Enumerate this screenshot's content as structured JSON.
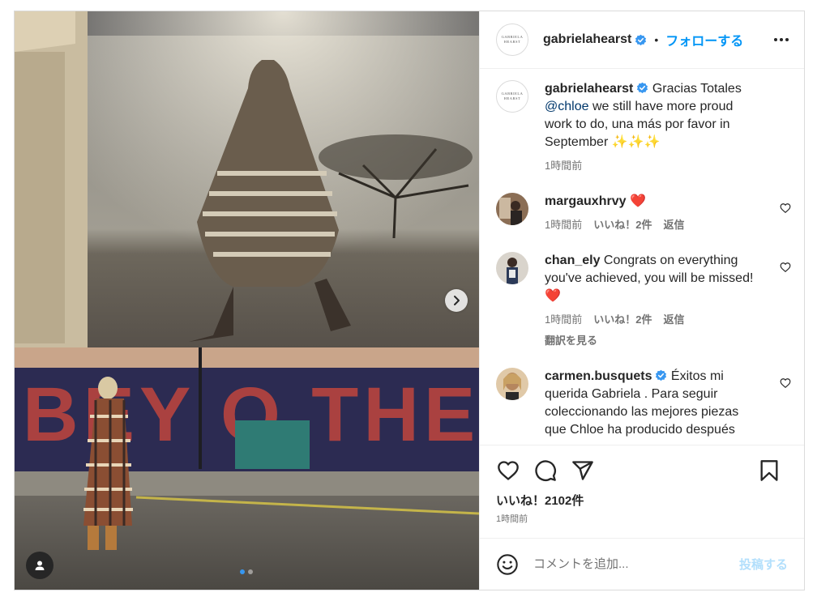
{
  "post": {
    "author": "gabrielahearst",
    "avatar_text": "GABRIELA HEARST",
    "separator": "•",
    "follow_label": "フォローする",
    "caption": {
      "user": "gabrielahearst",
      "text_before": " Gracias Totales ",
      "mention": "@chloe",
      "text_after": " we still have more proud work to do, una más por favor in September ✨✨✨",
      "time": "1時間前"
    },
    "comments": [
      {
        "user": "margauxhrvy",
        "text": " ❤️",
        "time": "1時間前",
        "likes": "いいね！2件",
        "reply": "返信"
      },
      {
        "user": "chan_ely",
        "text": " Congrats on everything you've achieved, you will be missed! ❤️",
        "time": "1時間前",
        "likes": "いいね！2件",
        "reply": "返信",
        "translate": "翻訳を見る"
      },
      {
        "user": "carmen.busquets",
        "text": " Éxitos mi querida Gabriela . Para seguir coleccionando las mejores piezas que Chloe ha producido después"
      }
    ],
    "like_count": "いいね！2102件",
    "posted_time": "1時間前",
    "comment_placeholder": "コメントを追加...",
    "post_label": "投稿する"
  },
  "colors": {
    "accent": "#0095f6",
    "verified": "#3897f0",
    "heart": "#ed4956",
    "post_disabled": "#b2dffc"
  },
  "icons": [
    "more-options-icon",
    "chevron-right-icon",
    "user-tag-icon",
    "heart-icon",
    "comment-icon",
    "share-icon",
    "bookmark-icon",
    "emoji-icon",
    "verified-badge-icon"
  ]
}
